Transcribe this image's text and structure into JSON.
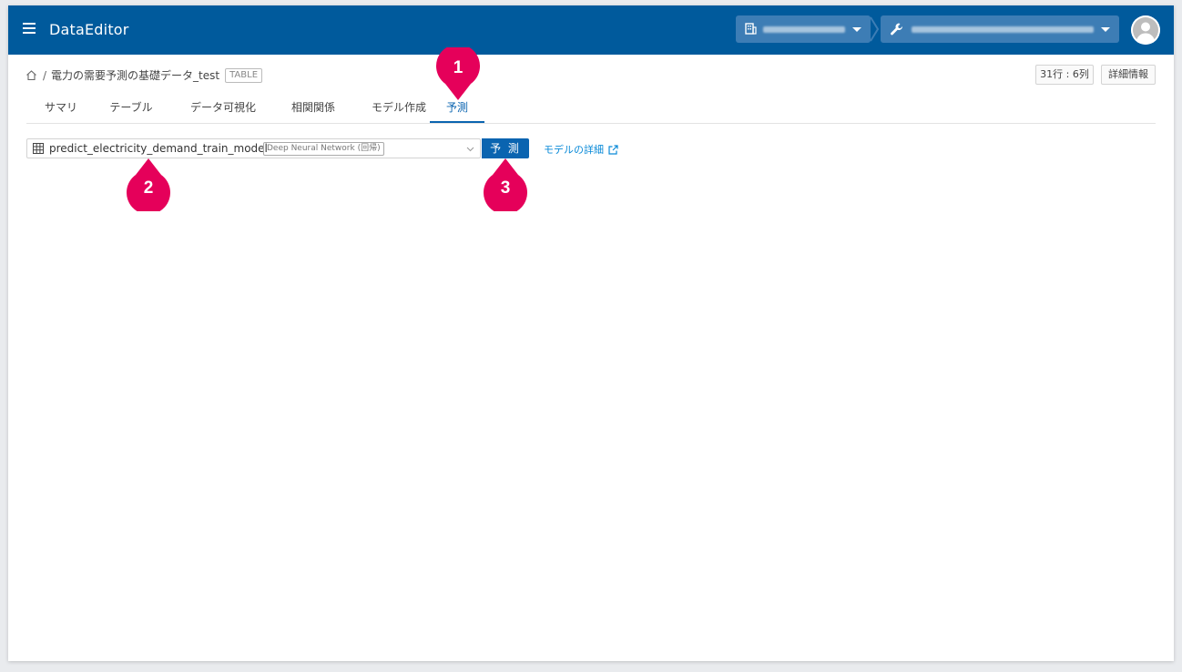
{
  "header": {
    "app_title": "DataEditor"
  },
  "breadcrumb": {
    "separator": "/",
    "dataset_name": "電力の需要予測の基礎データ_test",
    "dataset_tag": "TABLE"
  },
  "toolbar": {
    "row_col_count": "31行 : 6列",
    "detail_label": "詳細情報"
  },
  "tabs": [
    {
      "label": "サマリ"
    },
    {
      "label": "テーブル"
    },
    {
      "label": "データ可視化"
    },
    {
      "label": "相関関係"
    },
    {
      "label": "モデル作成"
    },
    {
      "label": "予測"
    }
  ],
  "active_tab": "予測",
  "predict_panel": {
    "model_name": "predict_electricity_demand_train_model",
    "model_type": "Deep Neural Network (回帰)",
    "predict_button": "予 測",
    "model_detail_link": "モデルの詳細"
  },
  "callouts": [
    {
      "number": "1"
    },
    {
      "number": "2"
    },
    {
      "number": "3"
    }
  ],
  "colors": {
    "header_bg": "#005a9c",
    "accent": "#0a64b0",
    "link": "#0a8ad8",
    "callout": "#e5005a"
  }
}
